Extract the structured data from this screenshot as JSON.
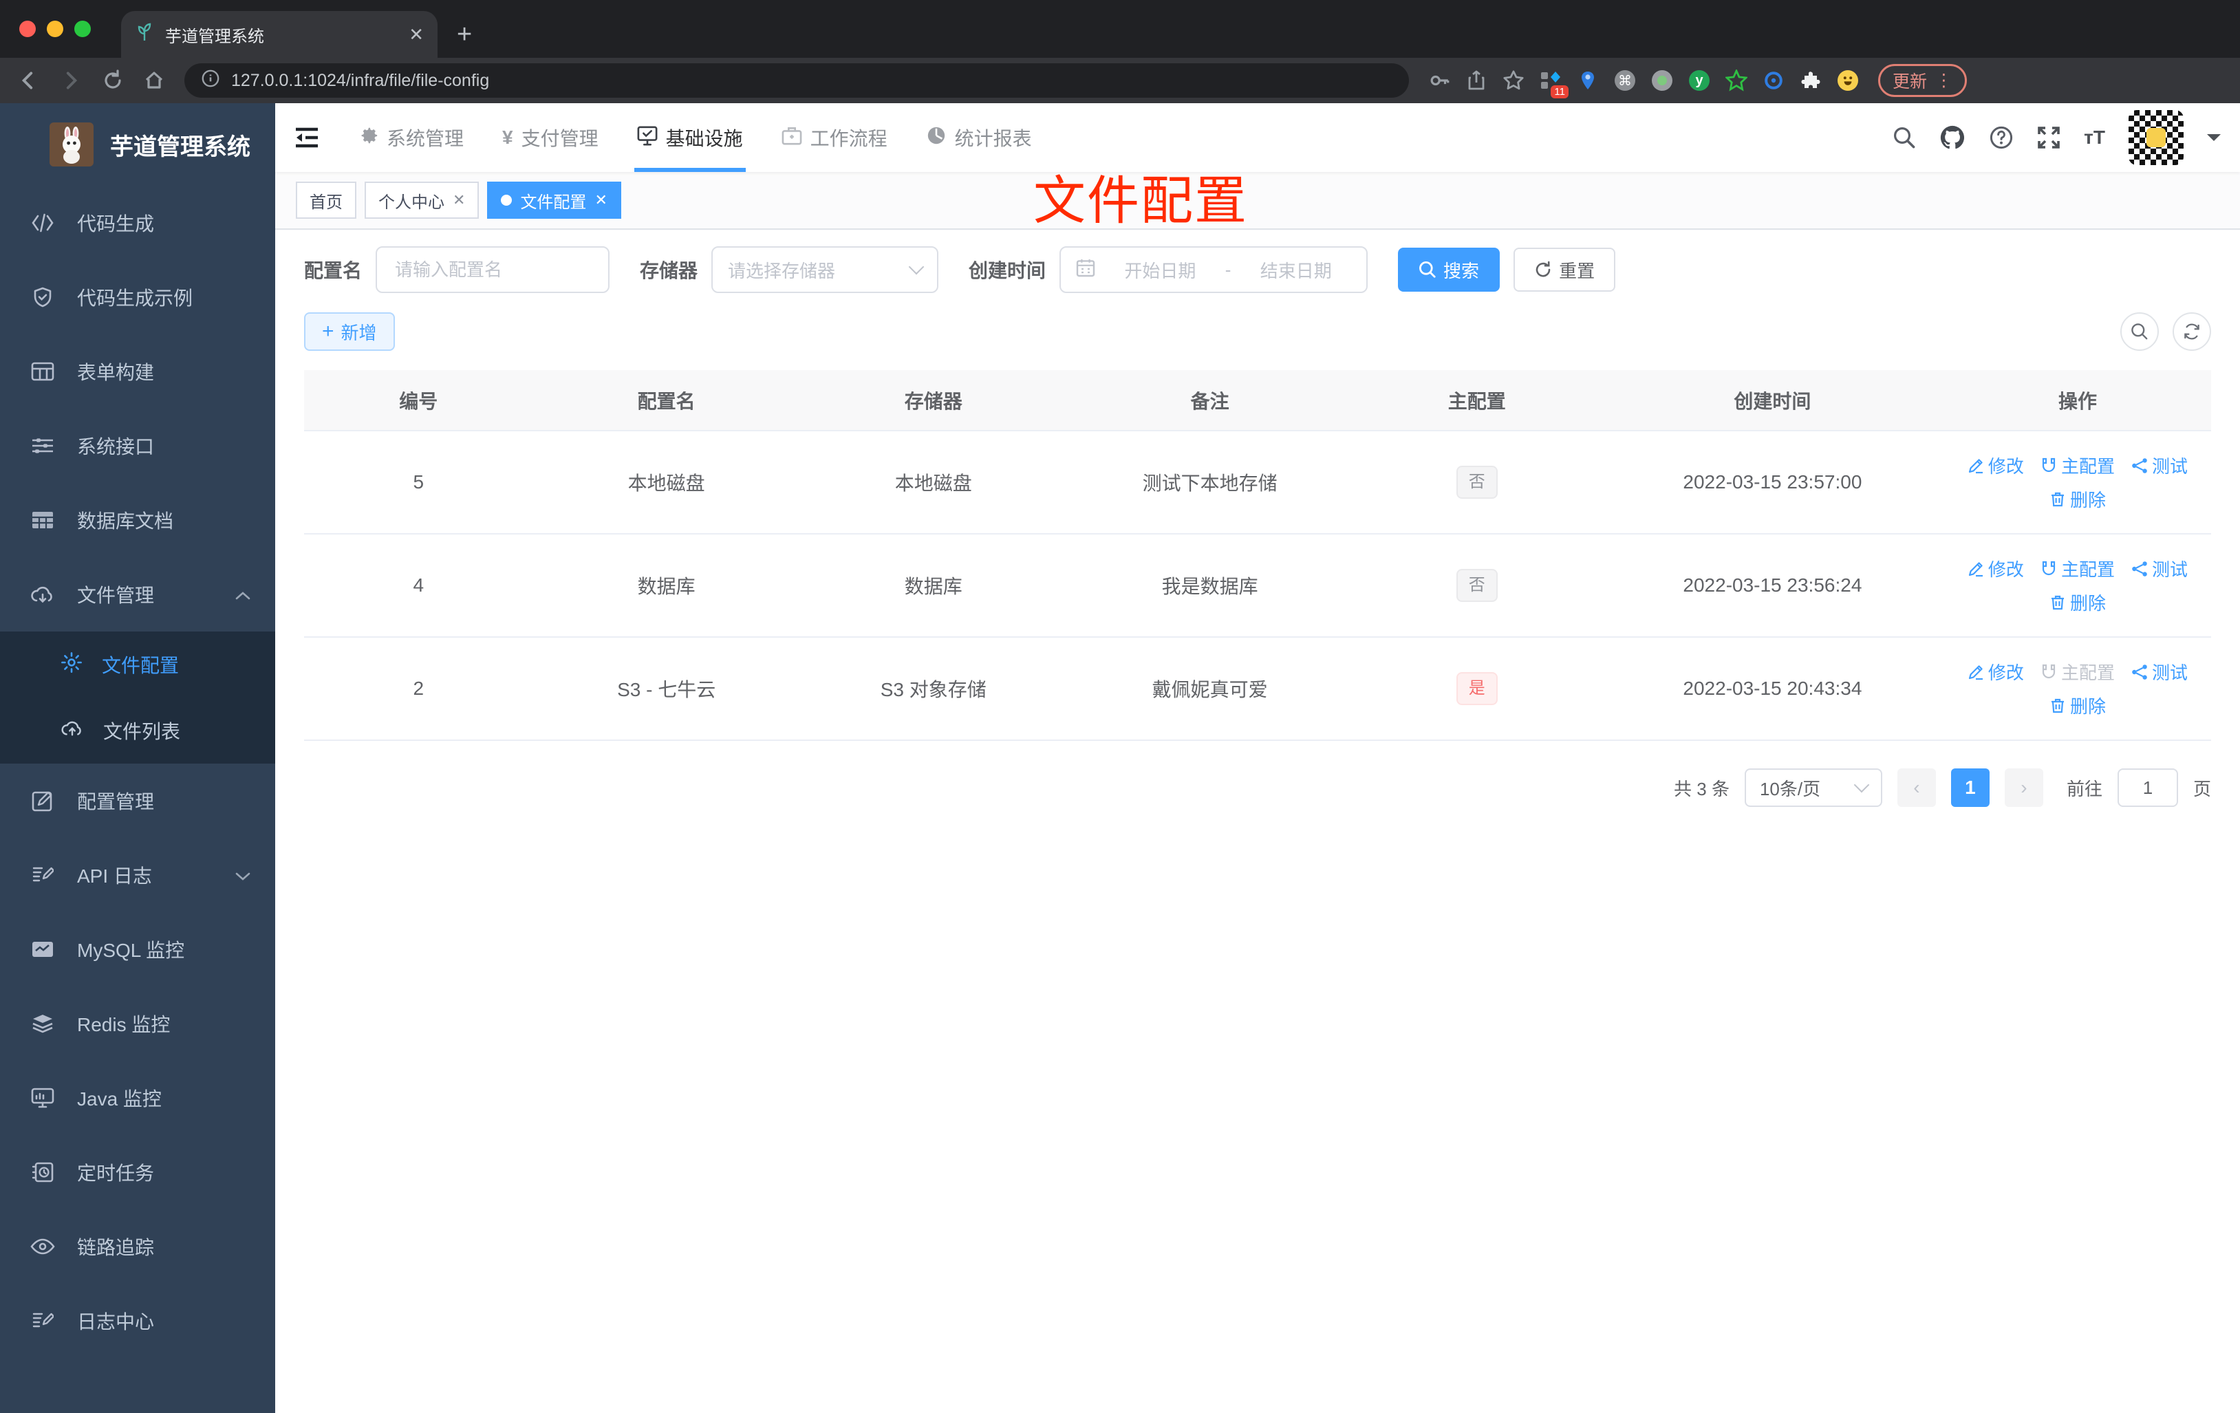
{
  "browser": {
    "tab_title": "芋道管理系统",
    "url": "127.0.0.1:1024/infra/file/file-config",
    "update_label": "更新",
    "extension_badge": "11"
  },
  "sidebar": {
    "title": "芋道管理系统",
    "items": [
      {
        "label": "代码生成"
      },
      {
        "label": "代码生成示例"
      },
      {
        "label": "表单构建"
      },
      {
        "label": "系统接口"
      },
      {
        "label": "数据库文档"
      },
      {
        "label": "文件管理",
        "expanded": true,
        "children": [
          {
            "label": "文件配置",
            "active": true
          },
          {
            "label": "文件列表"
          }
        ]
      },
      {
        "label": "配置管理"
      },
      {
        "label": "API 日志",
        "expanded": false
      },
      {
        "label": "MySQL 监控"
      },
      {
        "label": "Redis 监控"
      },
      {
        "label": "Java 监控"
      },
      {
        "label": "定时任务"
      },
      {
        "label": "链路追踪"
      },
      {
        "label": "日志中心"
      }
    ]
  },
  "topnav": {
    "items": [
      {
        "label": "系统管理"
      },
      {
        "label": "支付管理"
      },
      {
        "label": "基础设施",
        "active": true
      },
      {
        "label": "工作流程"
      },
      {
        "label": "统计报表"
      }
    ]
  },
  "tags": [
    {
      "label": "首页"
    },
    {
      "label": "个人中心",
      "closable": true
    },
    {
      "label": "文件配置",
      "closable": true,
      "active": true
    }
  ],
  "annotation": "文件配置",
  "filters": {
    "config_name_label": "配置名",
    "config_name_placeholder": "请输入配置名",
    "storage_label": "存储器",
    "storage_placeholder": "请选择存储器",
    "create_time_label": "创建时间",
    "start_placeholder": "开始日期",
    "range_separator": "-",
    "end_placeholder": "结束日期",
    "search_label": "搜索",
    "reset_label": "重置"
  },
  "toolbar": {
    "add_label": "新增"
  },
  "table": {
    "headers": [
      "编号",
      "配置名",
      "存储器",
      "备注",
      "主配置",
      "创建时间",
      "操作"
    ],
    "actions": {
      "edit": "修改",
      "master": "主配置",
      "test": "测试",
      "delete": "删除"
    },
    "rows": [
      {
        "id": "5",
        "name": "本地磁盘",
        "storage": "本地磁盘",
        "remark": "测试下本地存储",
        "master": "否",
        "master_type": "info",
        "time": "2022-03-15 23:57:00",
        "master_disabled": false
      },
      {
        "id": "4",
        "name": "数据库",
        "storage": "数据库",
        "remark": "我是数据库",
        "master": "否",
        "master_type": "info",
        "time": "2022-03-15 23:56:24",
        "master_disabled": false
      },
      {
        "id": "2",
        "name": "S3 - 七牛云",
        "storage": "S3 对象存储",
        "remark": "戴佩妮真可爱",
        "master": "是",
        "master_type": "danger",
        "time": "2022-03-15 20:43:34",
        "master_disabled": true
      }
    ]
  },
  "pagination": {
    "total": "共 3 条",
    "page_size": "10条/页",
    "prev": "‹",
    "current": "1",
    "next": "›",
    "goto_label": "前往",
    "goto_value": "1",
    "unit_label": "页"
  }
}
